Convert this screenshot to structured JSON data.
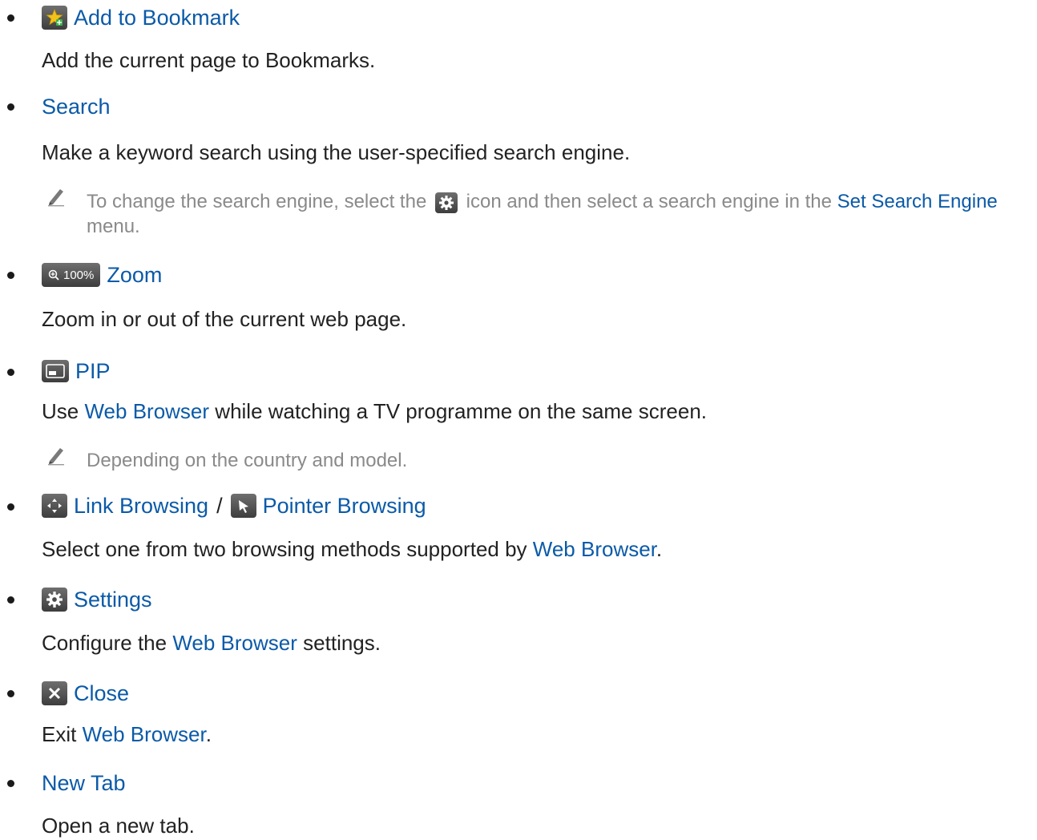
{
  "items": {
    "bookmark": {
      "title": "Add to Bookmark",
      "desc": "Add the current page to Bookmarks."
    },
    "search": {
      "title": "Search",
      "desc": "Make a keyword search using the user-specified search engine.",
      "note_part1": "To change the search engine, select the",
      "note_part2": "icon and then select a search engine in the",
      "note_link": "Set Search Engine",
      "note_part3": "menu."
    },
    "zoom": {
      "badge": "100%",
      "title": "Zoom",
      "desc": "Zoom in or out of the current web page."
    },
    "pip": {
      "title": "PIP",
      "desc_part1": "Use",
      "desc_link": "Web Browser",
      "desc_part2": "while watching a TV programme on the same screen.",
      "note": "Depending on the country and model."
    },
    "browsing": {
      "title1": "Link Browsing",
      "sep": "/",
      "title2": "Pointer Browsing",
      "desc_part1": "Select one from two browsing methods supported by",
      "desc_link": "Web Browser",
      "desc_part2": "."
    },
    "settings": {
      "title": "Settings",
      "desc_part1": "Configure the",
      "desc_link": "Web Browser",
      "desc_part2": "settings."
    },
    "close": {
      "title": "Close",
      "desc_part1": "Exit",
      "desc_link": "Web Browser",
      "desc_part2": "."
    },
    "newtab": {
      "title": "New Tab",
      "desc": "Open a new tab."
    }
  },
  "icons": {
    "bookmark": "star-plus-icon",
    "note": "pencil-icon",
    "gear": "gear-icon",
    "zoom": "magnifier-plus-icon",
    "pip": "pip-icon",
    "link_browsing": "four-arrows-icon",
    "pointer_browsing": "cursor-arrow-icon",
    "close": "close-icon"
  },
  "colors": {
    "link": "#0b5aa8",
    "text": "#222222",
    "note": "#8a8a8a",
    "icon_bg": "#4a4a4a",
    "star": "#f2c21a",
    "plus": "#3bb54a"
  }
}
